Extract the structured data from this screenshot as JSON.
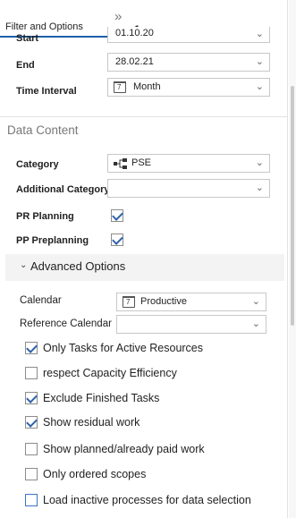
{
  "tabs": {
    "active_label": "Filter and Options",
    "more_chevron": "»",
    "count": "1"
  },
  "time": {
    "start_label": "Start",
    "start_value": "01.10.20",
    "end_label": "End",
    "end_value": "28.02.21",
    "interval_label": "Time Interval",
    "interval_value": "Month",
    "interval_icon": "calendar-icon"
  },
  "data_content": {
    "section_title": "Data Content",
    "category_label": "Category",
    "category_value": "PSE",
    "category_icon": "hierarchy-icon",
    "additional_category_label": "Additional Category",
    "additional_category_value": "",
    "pr_planning_label": "PR Planning",
    "pr_planning_checked": true,
    "pp_preplanning_label": "PP Preplanning",
    "pp_preplanning_checked": true
  },
  "advanced": {
    "title": "Advanced Options",
    "calendar_label": "Calendar",
    "calendar_value": "Productive",
    "reference_calendar_label": "Reference Calendar",
    "reference_calendar_value": "",
    "options": [
      {
        "label": "Only Tasks for Active Resources",
        "checked": true
      },
      {
        "label": "respect Capacity Efficiency",
        "checked": false
      },
      {
        "label": "Exclude Finished Tasks",
        "checked": true
      },
      {
        "label": "Show residual work",
        "checked": true
      },
      {
        "label": "Show planned/already paid work",
        "checked": false
      },
      {
        "label": "Only ordered scopes",
        "checked": false
      },
      {
        "label": "Load inactive processes for data selection",
        "checked": false
      }
    ]
  },
  "colors": {
    "accent": "#1d5fa8",
    "check": "#2f63a8"
  }
}
